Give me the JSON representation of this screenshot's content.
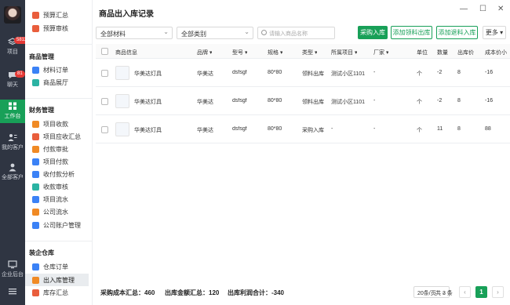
{
  "rail": {
    "badge_projects": "5812",
    "badge_chat": "81",
    "items": [
      {
        "label": "项目"
      },
      {
        "label": "聊天"
      },
      {
        "label": "工作台"
      },
      {
        "label": "我的客户"
      },
      {
        "label": "全部客户"
      },
      {
        "label": "企业后台"
      },
      {
        "label": "设置"
      }
    ]
  },
  "sidebar": {
    "top_items": [
      {
        "label": "预算汇总",
        "color": "#e95e3c"
      },
      {
        "label": "预算审核",
        "color": "#e95e3c"
      }
    ],
    "group_product": "商品管理",
    "product_items": [
      {
        "label": "材料订单",
        "color": "#3b82f6"
      },
      {
        "label": "商品展厅",
        "color": "#2bb3a3"
      }
    ],
    "group_finance": "财务管理",
    "finance_items": [
      {
        "label": "项目收款",
        "color": "#f08a24"
      },
      {
        "label": "项目应收汇总",
        "color": "#e95e3c"
      },
      {
        "label": "付款审批",
        "color": "#f08a24"
      },
      {
        "label": "项目付款",
        "color": "#3b82f6"
      },
      {
        "label": "收付款分析",
        "color": "#3b82f6"
      },
      {
        "label": "收款审核",
        "color": "#2bb3a3"
      },
      {
        "label": "项目流水",
        "color": "#3b82f6"
      },
      {
        "label": "公司流水",
        "color": "#f08a24"
      },
      {
        "label": "公司账户管理",
        "color": "#3b82f6"
      }
    ],
    "group_warehouse": "装企仓库",
    "warehouse_items": [
      {
        "label": "仓库订单",
        "color": "#3b82f6"
      },
      {
        "label": "出入库管理",
        "color": "#f08a24"
      },
      {
        "label": "库存汇总",
        "color": "#e95e3c"
      }
    ]
  },
  "header": {
    "title": "商品出入库记录"
  },
  "filters": {
    "material": "全部材料",
    "category": "全部类别",
    "search_placeholder": "请输入商品名称"
  },
  "buttons": {
    "purchase_in": "采购入库",
    "add_issue_out": "添加领料出库",
    "add_return_in": "添加退料入库",
    "more": "更多"
  },
  "table": {
    "columns": [
      "商品信息",
      "品牌",
      "型号",
      "规格",
      "类型",
      "所属项目",
      "厂家",
      "单位",
      "数量",
      "出库价",
      "成本价小"
    ],
    "rows": [
      {
        "name": "华美达灯具",
        "brand": "华美达",
        "model": "dsfsgf",
        "spec": "80*80",
        "type": "领料出库",
        "project": "测试小区1101",
        "vendor": "-",
        "unit": "个",
        "qty": "-2",
        "price": "8",
        "cost": "-16"
      },
      {
        "name": "华美达灯具",
        "brand": "华美达",
        "model": "dsfsgf",
        "spec": "80*80",
        "type": "领料出库",
        "project": "测试小区1101",
        "vendor": "-",
        "unit": "个",
        "qty": "-2",
        "price": "8",
        "cost": "-16"
      },
      {
        "name": "华美达灯具",
        "brand": "华美达",
        "model": "dsfsgf",
        "spec": "80*80",
        "type": "采购入库",
        "project": "-",
        "vendor": "-",
        "unit": "个",
        "qty": "11",
        "price": "8",
        "cost": "88"
      }
    ]
  },
  "footer": {
    "cost_total": "采购成本汇总：460",
    "amount_total": "出库金额汇总：120",
    "profit_total": "出库利润合计：-340",
    "page_size": "20条/页",
    "total": "共 3 条",
    "page": "1",
    "prev": "‹",
    "next": "›"
  }
}
